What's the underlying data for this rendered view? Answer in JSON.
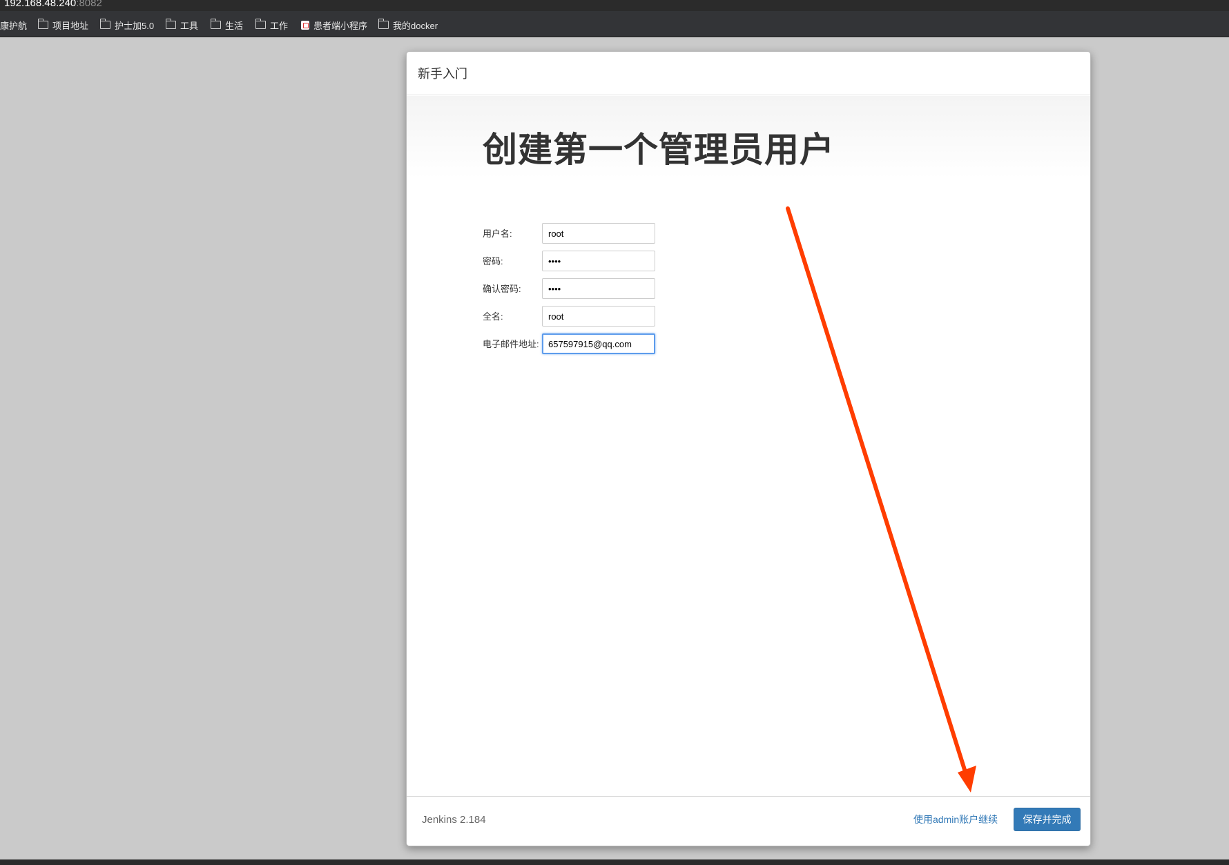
{
  "browser": {
    "url_host": "192.168.48.240",
    "url_port": ":8082"
  },
  "bookmarks": [
    {
      "label": "康护航",
      "icon": "none"
    },
    {
      "label": "项目地址",
      "icon": "folder-icon"
    },
    {
      "label": "护士加5.0",
      "icon": "folder-icon"
    },
    {
      "label": "工具",
      "icon": "folder-icon"
    },
    {
      "label": "生活",
      "icon": "folder-icon"
    },
    {
      "label": "工作",
      "icon": "folder-icon"
    },
    {
      "label": "患者端小程序",
      "icon": "page-icon"
    },
    {
      "label": "我的docker",
      "icon": "folder-icon"
    }
  ],
  "dialog": {
    "header_title": "新手入门",
    "main_title": "创建第一个管理员用户",
    "fields": [
      {
        "label": "用户名:",
        "value": "root",
        "type": "text"
      },
      {
        "label": "密码:",
        "value": "••••",
        "type": "password"
      },
      {
        "label": "确认密码:",
        "value": "••••",
        "type": "password"
      },
      {
        "label": "全名:",
        "value": "root",
        "type": "text"
      },
      {
        "label": "电子邮件地址:",
        "value": "657597915@qq.com",
        "type": "text",
        "focused": true
      }
    ],
    "footer": {
      "version": "Jenkins 2.184",
      "skip_link": "使用admin账户继续",
      "save_button": "保存并完成"
    }
  },
  "annotation": {
    "arrow_color": "#ff3d00"
  }
}
